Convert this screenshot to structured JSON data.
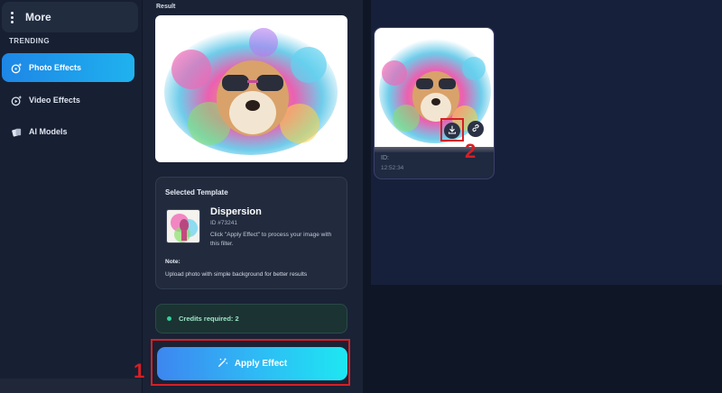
{
  "sidebar": {
    "more_label": "More",
    "section_title": "TRENDING",
    "items": [
      {
        "label": "Photo Effects",
        "icon": "sparkle-image-icon",
        "active": true
      },
      {
        "label": "Video Effects",
        "icon": "video-sparkle-icon",
        "active": false
      },
      {
        "label": "AI Models",
        "icon": "cards-icon",
        "active": false
      }
    ]
  },
  "result": {
    "label": "Result"
  },
  "template": {
    "heading": "Selected Template",
    "name": "Dispersion",
    "id_text": "ID #73241",
    "description": "Click \"Apply Effect\" to process your image with this filter.",
    "note_heading": "Note:",
    "note_text": "Upload photo with simple background for better results"
  },
  "credits": {
    "text": "Credits required: 2"
  },
  "apply_button": {
    "label": "Apply Effect",
    "icon": "magic-wand-icon"
  },
  "gallery": {
    "item": {
      "id_label": "ID:",
      "time": "12:52:34"
    }
  },
  "annotations": {
    "marker_1": "1",
    "marker_2": "2",
    "color": "#d61f26"
  },
  "colors": {
    "accent_start": "#1e86e6",
    "accent_end": "#1ee7f2",
    "credits_dot": "#2fd29a",
    "background": "#0f1727"
  }
}
